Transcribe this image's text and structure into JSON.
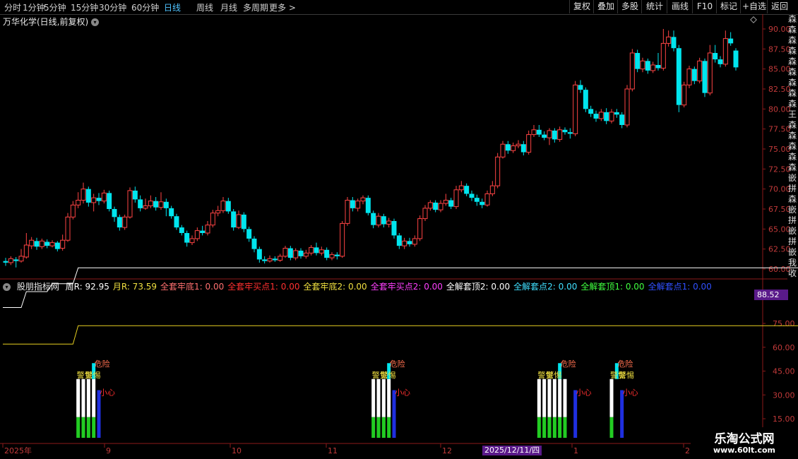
{
  "toolbar": {
    "periods": [
      "分时",
      "1分钟",
      "5分钟",
      "15分钟",
      "30分钟",
      "60分钟",
      "日线",
      "周线",
      "月线",
      "多周期",
      "更多 >"
    ],
    "active": "日线",
    "right_buttons": [
      "复权",
      "叠加",
      "多股",
      "统计",
      "画线",
      "F10",
      "标记",
      "+自选",
      "返回"
    ]
  },
  "stock": {
    "title": "万华化学(日线,前复权)"
  },
  "price_axis": [
    "90.00",
    "87.50",
    "85.00",
    "82.50",
    "80.00",
    "77.50",
    "75.00",
    "72.50",
    "70.00",
    "67.50",
    "65.00",
    "62.50",
    "60.00"
  ],
  "indicator": {
    "name": "股朋指标网",
    "params": [
      {
        "label": "周R: 92.95",
        "color": "#ffffff"
      },
      {
        "label": "月R: 73.59",
        "color": "#f0e040"
      },
      {
        "label": "全套牢底1: 0.00",
        "color": "#ff7070"
      },
      {
        "label": "全套牢买点1: 0.00",
        "color": "#ff3030"
      },
      {
        "label": "全套牢底2: 0.00",
        "color": "#f0e040"
      },
      {
        "label": "全套牢买点2: 0.00",
        "color": "#ff40ff"
      },
      {
        "label": "全解套顶2: 0.00",
        "color": "#ffffff"
      },
      {
        "label": "全解套点2: 0.00",
        "color": "#40e0ff"
      },
      {
        "label": "全解套顶1: 0.00",
        "color": "#40ff40"
      },
      {
        "label": "全解套点1: 0.00",
        "color": "#3050ff"
      }
    ],
    "axis": [
      "75.00",
      "60.00",
      "45.00",
      "30.00",
      "15.00"
    ],
    "current_value": "88.52",
    "signals": {
      "danger": "危险",
      "careful": "小心",
      "alert": "警觉",
      "vigilant": "警惕"
    }
  },
  "time_axis": [
    "2025年",
    "9",
    "10",
    "11",
    "12",
    "1",
    "2"
  ],
  "cursor_date": "2025/12/11/四",
  "watermark": {
    "name": "乐淘公式网",
    "url": "www.60lt.com"
  },
  "side_text": "森森森森森森森森森王森森森森森嵌拼森嵌拼嵌拼嵌我收",
  "colors": {
    "up": "#ff4444",
    "down": "#00e5ee",
    "week_line": "#ffffff",
    "month_line": "#e8d020",
    "grid": "#8b1a1a"
  },
  "chart_data": {
    "type": "candlestick",
    "price_range": [
      59,
      91
    ],
    "candles": [
      {
        "o": 61.0,
        "c": 60.8,
        "h": 61.4,
        "l": 60.4
      },
      {
        "o": 60.8,
        "c": 61.3,
        "h": 61.6,
        "l": 60.5
      },
      {
        "o": 61.2,
        "c": 61.0,
        "h": 61.5,
        "l": 60.2
      },
      {
        "o": 61.0,
        "c": 61.6,
        "h": 62.5,
        "l": 60.8
      },
      {
        "o": 61.5,
        "c": 63.0,
        "h": 64.5,
        "l": 61.3
      },
      {
        "o": 62.9,
        "c": 63.6,
        "h": 64.0,
        "l": 62.5
      },
      {
        "o": 63.5,
        "c": 62.8,
        "h": 63.9,
        "l": 62.4
      },
      {
        "o": 62.8,
        "c": 63.5,
        "h": 63.8,
        "l": 62.5
      },
      {
        "o": 63.4,
        "c": 62.9,
        "h": 63.7,
        "l": 62.6
      },
      {
        "o": 62.9,
        "c": 63.3,
        "h": 63.6,
        "l": 62.7
      },
      {
        "o": 63.3,
        "c": 62.5,
        "h": 63.5,
        "l": 62.2
      },
      {
        "o": 62.6,
        "c": 63.6,
        "h": 64.3,
        "l": 62.3
      },
      {
        "o": 63.6,
        "c": 66.5,
        "h": 67.0,
        "l": 63.4
      },
      {
        "o": 66.5,
        "c": 68.0,
        "h": 68.5,
        "l": 66.2
      },
      {
        "o": 68.0,
        "c": 68.6,
        "h": 69.6,
        "l": 67.6
      },
      {
        "o": 68.6,
        "c": 70.0,
        "h": 70.8,
        "l": 68.2
      },
      {
        "o": 70.0,
        "c": 68.3,
        "h": 70.3,
        "l": 67.8
      },
      {
        "o": 68.3,
        "c": 68.9,
        "h": 69.4,
        "l": 67.2
      },
      {
        "o": 68.9,
        "c": 68.5,
        "h": 69.5,
        "l": 68.0
      },
      {
        "o": 68.5,
        "c": 69.5,
        "h": 69.9,
        "l": 68.2
      },
      {
        "o": 69.5,
        "c": 67.5,
        "h": 69.8,
        "l": 67.2
      },
      {
        "o": 67.5,
        "c": 66.5,
        "h": 67.8,
        "l": 65.9
      },
      {
        "o": 66.5,
        "c": 65.2,
        "h": 66.8,
        "l": 64.8
      },
      {
        "o": 65.2,
        "c": 66.5,
        "h": 66.8,
        "l": 64.9
      },
      {
        "o": 66.5,
        "c": 69.8,
        "h": 70.2,
        "l": 66.3
      },
      {
        "o": 69.8,
        "c": 68.7,
        "h": 70.3,
        "l": 68.3
      },
      {
        "o": 68.7,
        "c": 67.6,
        "h": 69.2,
        "l": 67.2
      },
      {
        "o": 67.6,
        "c": 67.9,
        "h": 68.8,
        "l": 67.4
      },
      {
        "o": 67.9,
        "c": 68.5,
        "h": 69.2,
        "l": 67.6
      },
      {
        "o": 68.5,
        "c": 67.7,
        "h": 69.0,
        "l": 67.3
      },
      {
        "o": 67.7,
        "c": 68.4,
        "h": 69.6,
        "l": 67.4
      },
      {
        "o": 68.4,
        "c": 67.6,
        "h": 68.8,
        "l": 66.6
      },
      {
        "o": 67.6,
        "c": 66.6,
        "h": 67.9,
        "l": 66.3
      },
      {
        "o": 66.6,
        "c": 65.2,
        "h": 66.9,
        "l": 64.9
      },
      {
        "o": 65.2,
        "c": 64.5,
        "h": 65.5,
        "l": 64.2
      },
      {
        "o": 64.5,
        "c": 63.3,
        "h": 64.8,
        "l": 62.8
      },
      {
        "o": 63.3,
        "c": 63.8,
        "h": 64.2,
        "l": 63.0
      },
      {
        "o": 63.8,
        "c": 64.8,
        "h": 65.2,
        "l": 63.5
      },
      {
        "o": 64.8,
        "c": 64.5,
        "h": 65.4,
        "l": 64.2
      },
      {
        "o": 64.5,
        "c": 65.5,
        "h": 66.0,
        "l": 64.2
      },
      {
        "o": 65.5,
        "c": 67.0,
        "h": 67.4,
        "l": 65.2
      },
      {
        "o": 67.0,
        "c": 67.3,
        "h": 67.9,
        "l": 66.6
      },
      {
        "o": 67.3,
        "c": 68.5,
        "h": 69.0,
        "l": 67.0
      },
      {
        "o": 68.5,
        "c": 67.2,
        "h": 68.9,
        "l": 66.9
      },
      {
        "o": 67.2,
        "c": 65.2,
        "h": 67.5,
        "l": 64.8
      },
      {
        "o": 65.2,
        "c": 66.8,
        "h": 67.3,
        "l": 65.0
      },
      {
        "o": 66.8,
        "c": 65.0,
        "h": 67.1,
        "l": 64.6
      },
      {
        "o": 65.0,
        "c": 63.8,
        "h": 65.3,
        "l": 63.4
      },
      {
        "o": 63.8,
        "c": 62.5,
        "h": 64.1,
        "l": 62.1
      },
      {
        "o": 62.5,
        "c": 61.2,
        "h": 62.8,
        "l": 60.8
      },
      {
        "o": 61.2,
        "c": 61.0,
        "h": 61.6,
        "l": 60.7
      },
      {
        "o": 61.0,
        "c": 61.3,
        "h": 61.7,
        "l": 60.8
      },
      {
        "o": 61.3,
        "c": 61.1,
        "h": 61.6,
        "l": 60.9
      },
      {
        "o": 61.1,
        "c": 61.6,
        "h": 61.9,
        "l": 60.9
      },
      {
        "o": 61.6,
        "c": 62.6,
        "h": 62.9,
        "l": 61.4
      },
      {
        "o": 62.6,
        "c": 61.4,
        "h": 62.9,
        "l": 61.1
      },
      {
        "o": 61.4,
        "c": 62.3,
        "h": 62.6,
        "l": 61.1
      },
      {
        "o": 62.3,
        "c": 61.6,
        "h": 62.6,
        "l": 61.3
      },
      {
        "o": 61.6,
        "c": 62.0,
        "h": 62.4,
        "l": 61.3
      },
      {
        "o": 62.0,
        "c": 62.7,
        "h": 63.0,
        "l": 61.7
      },
      {
        "o": 62.7,
        "c": 62.0,
        "h": 63.3,
        "l": 61.7
      },
      {
        "o": 62.0,
        "c": 62.4,
        "h": 62.8,
        "l": 61.7
      },
      {
        "o": 62.4,
        "c": 61.4,
        "h": 62.7,
        "l": 61.1
      },
      {
        "o": 61.4,
        "c": 61.8,
        "h": 62.1,
        "l": 61.1
      },
      {
        "o": 61.8,
        "c": 61.6,
        "h": 62.1,
        "l": 61.2
      },
      {
        "o": 61.6,
        "c": 65.7,
        "h": 66.0,
        "l": 61.4
      },
      {
        "o": 65.7,
        "c": 68.6,
        "h": 69.0,
        "l": 65.4
      },
      {
        "o": 68.6,
        "c": 67.6,
        "h": 69.0,
        "l": 67.2
      },
      {
        "o": 67.6,
        "c": 68.5,
        "h": 68.8,
        "l": 67.2
      },
      {
        "o": 68.5,
        "c": 68.9,
        "h": 69.2,
        "l": 68.1
      },
      {
        "o": 68.9,
        "c": 67.0,
        "h": 69.2,
        "l": 66.7
      },
      {
        "o": 67.0,
        "c": 65.5,
        "h": 67.3,
        "l": 65.1
      },
      {
        "o": 65.5,
        "c": 66.6,
        "h": 67.0,
        "l": 65.2
      },
      {
        "o": 66.6,
        "c": 65.6,
        "h": 66.9,
        "l": 65.2
      },
      {
        "o": 65.6,
        "c": 66.0,
        "h": 66.4,
        "l": 65.2
      },
      {
        "o": 66.0,
        "c": 64.2,
        "h": 66.3,
        "l": 63.8
      },
      {
        "o": 64.2,
        "c": 62.9,
        "h": 64.5,
        "l": 62.5
      },
      {
        "o": 62.9,
        "c": 63.5,
        "h": 63.9,
        "l": 62.5
      },
      {
        "o": 63.5,
        "c": 63.1,
        "h": 63.9,
        "l": 62.8
      },
      {
        "o": 63.1,
        "c": 63.8,
        "h": 64.2,
        "l": 62.8
      },
      {
        "o": 63.8,
        "c": 66.3,
        "h": 66.7,
        "l": 63.5
      },
      {
        "o": 66.3,
        "c": 67.6,
        "h": 68.0,
        "l": 66.0
      },
      {
        "o": 67.6,
        "c": 68.3,
        "h": 68.6,
        "l": 67.3
      },
      {
        "o": 68.3,
        "c": 67.4,
        "h": 68.6,
        "l": 67.1
      },
      {
        "o": 67.4,
        "c": 68.2,
        "h": 68.6,
        "l": 67.1
      },
      {
        "o": 68.2,
        "c": 68.6,
        "h": 69.4,
        "l": 67.9
      },
      {
        "o": 68.6,
        "c": 67.8,
        "h": 68.9,
        "l": 67.5
      },
      {
        "o": 67.8,
        "c": 69.9,
        "h": 70.4,
        "l": 67.5
      },
      {
        "o": 69.9,
        "c": 70.4,
        "h": 71.0,
        "l": 69.6
      },
      {
        "o": 70.4,
        "c": 69.4,
        "h": 70.7,
        "l": 69.1
      },
      {
        "o": 69.4,
        "c": 68.9,
        "h": 69.8,
        "l": 68.5
      },
      {
        "o": 68.9,
        "c": 68.4,
        "h": 69.3,
        "l": 67.9
      },
      {
        "o": 68.4,
        "c": 68.0,
        "h": 68.8,
        "l": 67.6
      },
      {
        "o": 68.0,
        "c": 69.4,
        "h": 69.8,
        "l": 67.8
      },
      {
        "o": 69.4,
        "c": 70.4,
        "h": 71.0,
        "l": 69.1
      },
      {
        "o": 70.4,
        "c": 74.0,
        "h": 74.5,
        "l": 70.1
      },
      {
        "o": 74.0,
        "c": 75.6,
        "h": 76.0,
        "l": 73.8
      },
      {
        "o": 75.6,
        "c": 74.8,
        "h": 76.0,
        "l": 74.4
      },
      {
        "o": 74.8,
        "c": 75.4,
        "h": 75.8,
        "l": 74.5
      },
      {
        "o": 75.4,
        "c": 75.6,
        "h": 76.1,
        "l": 75.1
      },
      {
        "o": 75.6,
        "c": 74.6,
        "h": 76.0,
        "l": 74.2
      },
      {
        "o": 74.6,
        "c": 76.8,
        "h": 77.3,
        "l": 74.3
      },
      {
        "o": 76.8,
        "c": 77.4,
        "h": 78.0,
        "l": 76.5
      },
      {
        "o": 77.4,
        "c": 76.8,
        "h": 78.0,
        "l": 76.5
      },
      {
        "o": 76.8,
        "c": 76.4,
        "h": 77.2,
        "l": 76.1
      },
      {
        "o": 76.4,
        "c": 77.3,
        "h": 77.6,
        "l": 75.5
      },
      {
        "o": 77.3,
        "c": 76.2,
        "h": 77.6,
        "l": 75.8
      },
      {
        "o": 76.2,
        "c": 77.4,
        "h": 77.8,
        "l": 75.9
      },
      {
        "o": 77.4,
        "c": 77.1,
        "h": 77.7,
        "l": 76.8
      },
      {
        "o": 77.1,
        "c": 76.9,
        "h": 77.6,
        "l": 76.3
      },
      {
        "o": 76.9,
        "c": 83.0,
        "h": 83.5,
        "l": 76.6
      },
      {
        "o": 83.0,
        "c": 82.4,
        "h": 83.6,
        "l": 82.0
      },
      {
        "o": 82.4,
        "c": 80.0,
        "h": 82.7,
        "l": 79.6
      },
      {
        "o": 80.0,
        "c": 79.4,
        "h": 80.4,
        "l": 79.0
      },
      {
        "o": 79.4,
        "c": 78.8,
        "h": 79.8,
        "l": 78.4
      },
      {
        "o": 78.8,
        "c": 79.6,
        "h": 80.0,
        "l": 78.5
      },
      {
        "o": 79.6,
        "c": 78.5,
        "h": 80.1,
        "l": 78.1
      },
      {
        "o": 78.5,
        "c": 79.6,
        "h": 80.0,
        "l": 78.2
      },
      {
        "o": 79.6,
        "c": 79.3,
        "h": 80.0,
        "l": 78.9
      },
      {
        "o": 79.3,
        "c": 78.0,
        "h": 79.6,
        "l": 77.6
      },
      {
        "o": 78.0,
        "c": 82.5,
        "h": 83.0,
        "l": 77.7
      },
      {
        "o": 82.5,
        "c": 87.0,
        "h": 87.5,
        "l": 82.2
      },
      {
        "o": 87.0,
        "c": 85.0,
        "h": 87.4,
        "l": 84.6
      },
      {
        "o": 85.0,
        "c": 86.0,
        "h": 86.4,
        "l": 84.6
      },
      {
        "o": 86.0,
        "c": 84.8,
        "h": 86.3,
        "l": 84.4
      },
      {
        "o": 84.8,
        "c": 85.5,
        "h": 85.9,
        "l": 84.5
      },
      {
        "o": 85.5,
        "c": 85.1,
        "h": 87.0,
        "l": 84.8
      },
      {
        "o": 85.1,
        "c": 88.2,
        "h": 90.0,
        "l": 84.8
      },
      {
        "o": 88.2,
        "c": 89.0,
        "h": 89.8,
        "l": 87.8
      },
      {
        "o": 89.0,
        "c": 87.6,
        "h": 89.8,
        "l": 87.2
      },
      {
        "o": 87.6,
        "c": 80.5,
        "h": 88.0,
        "l": 79.6
      },
      {
        "o": 80.5,
        "c": 83.0,
        "h": 83.4,
        "l": 80.2
      },
      {
        "o": 83.0,
        "c": 85.0,
        "h": 85.4,
        "l": 82.6
      },
      {
        "o": 85.0,
        "c": 83.5,
        "h": 85.3,
        "l": 83.1
      },
      {
        "o": 83.5,
        "c": 86.0,
        "h": 86.4,
        "l": 83.2
      },
      {
        "o": 86.0,
        "c": 82.0,
        "h": 86.3,
        "l": 81.5
      },
      {
        "o": 82.0,
        "c": 87.0,
        "h": 88.0,
        "l": 81.7
      },
      {
        "o": 87.0,
        "c": 86.2,
        "h": 88.0,
        "l": 85.8
      },
      {
        "o": 86.2,
        "c": 85.6,
        "h": 86.6,
        "l": 85.2
      },
      {
        "o": 85.6,
        "c": 88.8,
        "h": 89.8,
        "l": 85.3
      },
      {
        "o": 88.8,
        "c": 88.2,
        "h": 89.6,
        "l": 87.9
      },
      {
        "o": 87.3,
        "c": 85.2,
        "h": 87.6,
        "l": 84.8
      }
    ],
    "week_R_line": [
      {
        "bar": 0,
        "v": 85
      },
      {
        "bar": 3,
        "v": 85
      },
      {
        "bar": 4,
        "v": 95
      },
      {
        "bar": 8,
        "v": 95
      },
      {
        "bar": 9,
        "v": 100
      },
      {
        "bar": 13,
        "v": 100
      },
      {
        "bar": 14,
        "v": 110
      },
      {
        "bar": 153,
        "v": 110
      }
    ],
    "month_R_line": [
      {
        "bar": 0,
        "v": 62
      },
      {
        "bar": 13,
        "v": 62
      },
      {
        "bar": 14,
        "v": 73.59
      },
      {
        "bar": 153,
        "v": 73.59
      }
    ],
    "signal_groups": [
      {
        "bars": [
          14,
          15,
          16,
          17
        ],
        "cyan_bar": 17,
        "blue_bar": 18
      },
      {
        "bars": [
          71,
          72,
          73,
          74
        ],
        "cyan_bar": 74,
        "blue_bar": 75
      },
      {
        "bars": [
          103,
          104,
          105,
          106,
          107,
          108
        ],
        "cyan_bar": 107,
        "blue_bar": 110
      },
      {
        "bars": [
          117
        ],
        "cyan_bar": 118,
        "blue_bar": 119
      }
    ],
    "indicator_range": [
      0,
      100
    ]
  }
}
